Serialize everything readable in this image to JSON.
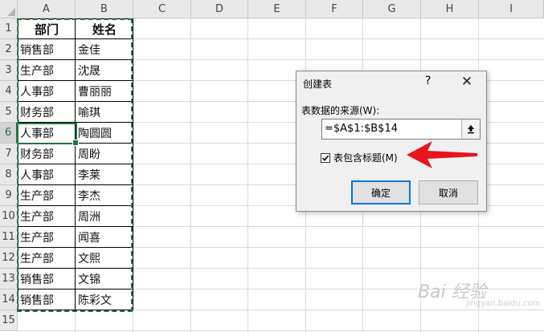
{
  "columns": [
    "A",
    "B",
    "C",
    "D",
    "E",
    "F",
    "G",
    "H",
    "I"
  ],
  "rows": [
    "1",
    "2",
    "3",
    "4",
    "5",
    "6",
    "7",
    "8",
    "9",
    "10",
    "11",
    "12",
    "13",
    "14",
    "15"
  ],
  "table": {
    "header": [
      "部门",
      "姓名"
    ],
    "rows": [
      [
        "销售部",
        "金佳"
      ],
      [
        "生产部",
        "沈晟"
      ],
      [
        "人事部",
        "曹丽丽"
      ],
      [
        "财务部",
        "喻琪"
      ],
      [
        "人事部",
        "陶圆圆"
      ],
      [
        "财务部",
        "周盼"
      ],
      [
        "人事部",
        "李莱"
      ],
      [
        "生产部",
        "李杰"
      ],
      [
        "生产部",
        "周洲"
      ],
      [
        "生产部",
        "闻喜"
      ],
      [
        "生产部",
        "文熙"
      ],
      [
        "销售部",
        "文锦"
      ],
      [
        "销售部",
        "陈彩文"
      ]
    ]
  },
  "dialog": {
    "title": "创建表",
    "help": "?",
    "close": "✕",
    "source_label": "表数据的来源(W):",
    "source_value": "=$A$1:$B$14",
    "header_checkbox_label": "表包含标题(M)",
    "header_checked": true,
    "ok_label": "确定",
    "cancel_label": "取消"
  },
  "watermark": {
    "text": "Bai 经验",
    "subtext": "jingyan.baidu.com"
  },
  "colors": {
    "accent_green": "#217346",
    "annotation_arrow": "#e8141b",
    "ok_border": "#0078d7"
  }
}
